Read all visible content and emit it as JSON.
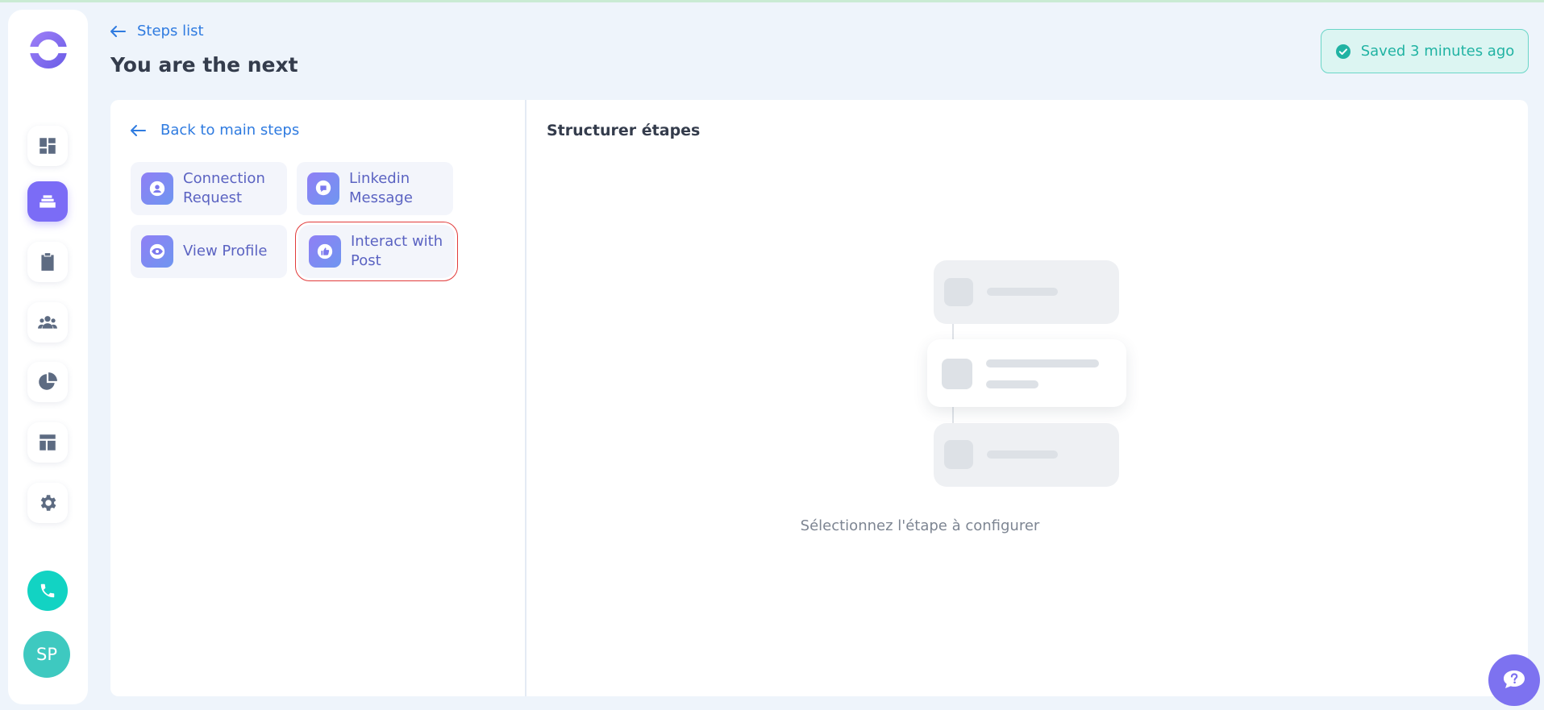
{
  "header": {
    "breadcrumb_label": "Steps list",
    "page_title": "You are the next",
    "saved_status": "Saved 3 minutes ago"
  },
  "sidebar": {
    "nav_items": [
      {
        "icon": "dashboard-icon",
        "active": false
      },
      {
        "icon": "campaigns-icon",
        "active": true
      },
      {
        "icon": "clipboard-list-icon",
        "active": false
      },
      {
        "icon": "people-icon",
        "active": false
      },
      {
        "icon": "pie-chart-icon",
        "active": false
      },
      {
        "icon": "layout-template-icon",
        "active": false
      },
      {
        "icon": "gear-icon",
        "active": false
      }
    ],
    "phone_icon": "phone-icon",
    "avatar_initials": "SP"
  },
  "left_panel": {
    "back_label": "Back to main steps",
    "steps": [
      {
        "label": "Connection Request",
        "icon": "person-icon"
      },
      {
        "label": "Linkedin Message",
        "icon": "message-icon"
      },
      {
        "label": "View Profile",
        "icon": "eye-icon"
      },
      {
        "label": "Interact with Post",
        "icon": "thumbs-up-icon",
        "highlighted": true
      }
    ]
  },
  "right_panel": {
    "title": "Structurer étapes",
    "empty_state": "Sélectionnez l'étape à configurer"
  },
  "colors": {
    "accent_blue": "#2f7be0",
    "primary_purple": "#7b6cf6",
    "success_teal": "#21b3a3",
    "highlight_red": "#e13b3b"
  }
}
